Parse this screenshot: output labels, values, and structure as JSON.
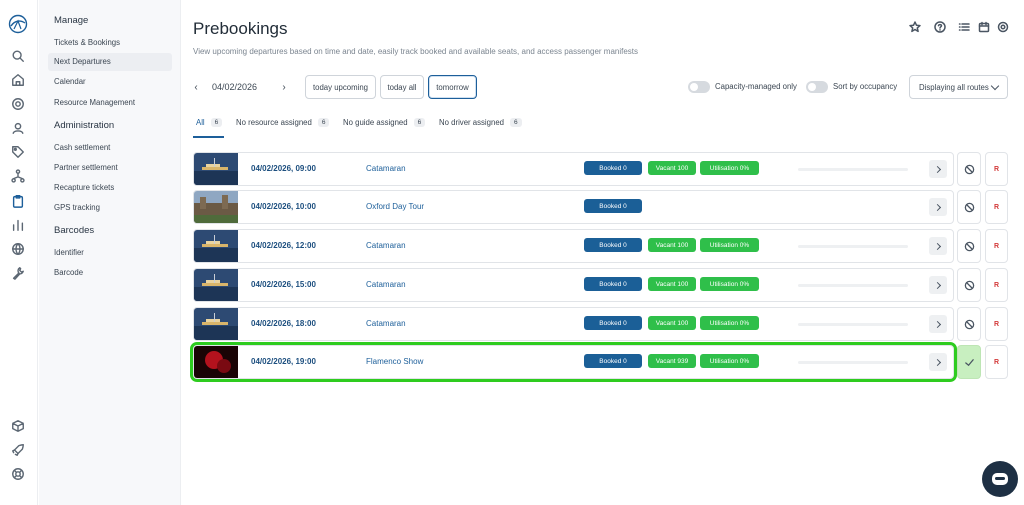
{
  "sidebar": {
    "sections": [
      {
        "title": "Manage",
        "items": [
          "Tickets & Bookings",
          "Next Departures",
          "Calendar",
          "Resource Management"
        ]
      },
      {
        "title": "Administration",
        "items": [
          "Cash settlement",
          "Partner settlement",
          "Recapture tickets",
          "GPS tracking"
        ]
      },
      {
        "title": "Barcodes",
        "items": [
          "Identifier",
          "Barcode"
        ]
      }
    ],
    "active_item": "Next Departures"
  },
  "header": {
    "title": "Prebookings",
    "subtitle": "View upcoming departures based on time and date, easily track booked and available seats, and access passenger manifests"
  },
  "filters": {
    "date": "04/02/2026",
    "buttons": [
      "today upcoming",
      "today all",
      "tomorrow"
    ],
    "selected_button": "tomorrow",
    "capacity_toggle_label": "Capacity-managed only",
    "occupancy_toggle_label": "Sort by occupancy",
    "routes_select": "Displaying all routes"
  },
  "tabs": [
    {
      "label": "All",
      "count": "6"
    },
    {
      "label": "No resource assigned",
      "count": "6"
    },
    {
      "label": "No guide assigned",
      "count": "6"
    },
    {
      "label": "No driver assigned",
      "count": "6"
    }
  ],
  "rows": [
    {
      "datetime": "04/02/2026, 09:00",
      "name": "Catamaran",
      "booked": "Booked 0",
      "vacant": "Vacant 100",
      "utilisation": "Utilisation 0%",
      "thumb": "catamaran",
      "action_icon": "block-icon",
      "r_label": "R"
    },
    {
      "datetime": "04/02/2026, 10:00",
      "name": "Oxford Day Tour",
      "booked": "Booked 0",
      "thumb": "oxford",
      "action_icon": "block-icon",
      "r_label": "R"
    },
    {
      "datetime": "04/02/2026, 12:00",
      "name": "Catamaran",
      "booked": "Booked 0",
      "vacant": "Vacant 100",
      "utilisation": "Utilisation 0%",
      "thumb": "catamaran",
      "action_icon": "block-icon",
      "r_label": "R"
    },
    {
      "datetime": "04/02/2026, 15:00",
      "name": "Catamaran",
      "booked": "Booked 0",
      "vacant": "Vacant 100",
      "utilisation": "Utilisation 0%",
      "thumb": "catamaran",
      "action_icon": "block-icon",
      "r_label": "R"
    },
    {
      "datetime": "04/02/2026, 18:00",
      "name": "Catamaran",
      "booked": "Booked 0",
      "vacant": "Vacant 100",
      "utilisation": "Utilisation 0%",
      "thumb": "catamaran",
      "action_icon": "block-icon",
      "r_label": "R"
    },
    {
      "datetime": "04/02/2026, 19:00",
      "name": "Flamenco Show",
      "booked": "Booked 0",
      "vacant": "Vacant 939",
      "utilisation": "Utilisation 0%",
      "thumb": "flamenco",
      "action_icon": "check-icon",
      "r_label": "R"
    }
  ],
  "colors": {
    "accent": "#1d5f9a",
    "booked": "#1b5f97",
    "vacant": "#2fbf4a",
    "highlight": "#2ecc1f",
    "r_label": "#d33a3a"
  }
}
